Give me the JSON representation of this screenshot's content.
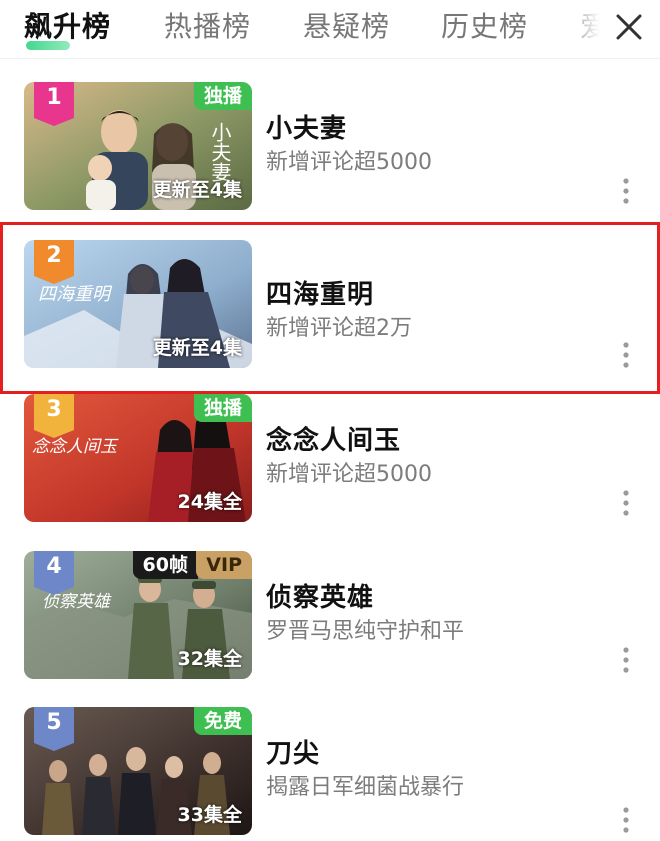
{
  "tabs": [
    {
      "label": "飙升榜",
      "active": true
    },
    {
      "label": "热播榜",
      "active": false
    },
    {
      "label": "悬疑榜",
      "active": false
    },
    {
      "label": "历史榜",
      "active": false
    },
    {
      "label": "爱",
      "active": false
    }
  ],
  "items": [
    {
      "rank": "1",
      "title": "小夫妻",
      "subtitle": "新增评论超5000",
      "tag": "独播",
      "fps": "",
      "episodes": "更新至4集",
      "highlighted": false
    },
    {
      "rank": "2",
      "title": "四海重明",
      "subtitle": "新增评论超2万",
      "tag": "",
      "fps": "",
      "episodes": "更新至4集",
      "highlighted": true
    },
    {
      "rank": "3",
      "title": "念念人间玉",
      "subtitle": "新增评论超5000",
      "tag": "独播",
      "fps": "",
      "episodes": "24集全",
      "highlighted": false
    },
    {
      "rank": "4",
      "title": "侦察英雄",
      "subtitle": "罗晋马思纯守护和平",
      "tag": "VIP",
      "fps": "60帧",
      "episodes": "32集全",
      "highlighted": false
    },
    {
      "rank": "5",
      "title": "刀尖",
      "subtitle": "揭露日军细菌战暴行",
      "tag": "免费",
      "fps": "",
      "episodes": "33集全",
      "highlighted": false
    }
  ],
  "poster_texts": [
    "小夫妻",
    "四海重明",
    "念念人间玉",
    "侦察英雄"
  ],
  "colors": {
    "rank1": "#e8368f",
    "rank2": "#f08a2c",
    "rank3": "#f2b33d",
    "rank4": "#6e87c9",
    "rank5": "#6e87c9",
    "tag_green": "#3fbf52",
    "tag_vip": "#c9a165",
    "highlight": "#e41f1f",
    "accent": "#22d07a"
  },
  "icons": {
    "close": "close-icon",
    "more": "more-vertical-icon"
  }
}
